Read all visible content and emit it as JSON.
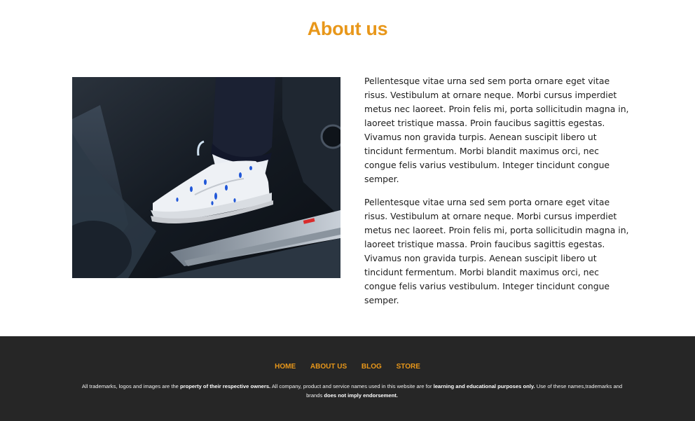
{
  "page": {
    "title": "About us"
  },
  "about": {
    "paragraphs": [
      "Pellentesque vitae urna sed sem porta ornare eget vitae risus. Vestibulum at ornare neque. Morbi cursus imperdiet metus nec laoreet. Proin felis mi, porta sollicitudin magna in, laoreet tristique massa. Proin faucibus sagittis egestas. Vivamus non gravida turpis. Aenean suscipit libero ut tincidunt fermentum. Morbi blandit maximus orci, nec congue felis varius vestibulum. Integer tincidunt congue semper.",
      "Pellentesque vitae urna sed sem porta ornare eget vitae risus. Vestibulum at ornare neque. Morbi cursus imperdiet metus nec laoreet. Proin felis mi, porta sollicitudin magna in, laoreet tristique massa. Proin faucibus sagittis egestas. Vivamus non gravida turpis. Aenean suscipit libero ut tincidunt fermentum. Morbi blandit maximus orci, nec congue felis varius vestibulum. Integer tincidunt congue semper."
    ]
  },
  "footer": {
    "nav": [
      "HOME",
      "ABOUT US",
      "BLOG",
      "STORE"
    ],
    "legal": {
      "part1": "All trademarks, logos and images are the ",
      "bold1": "property of their respective owners.",
      "part2": " All company, product and service names used in this website are for ",
      "bold2": "learning and educational purposes only.",
      "part3": " Use of these names,trademarks and brands ",
      "bold3": "does not imply endorsement."
    }
  },
  "colors": {
    "accent": "#e8971a",
    "footer_bg": "#262626"
  }
}
